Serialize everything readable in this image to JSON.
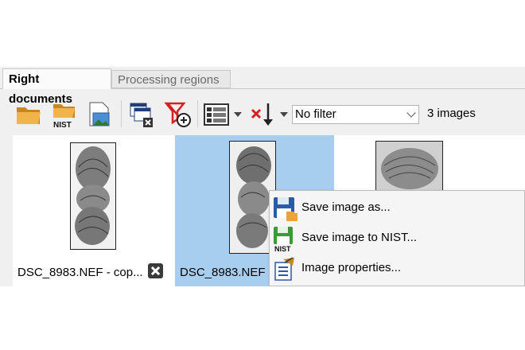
{
  "tabs": [
    {
      "label": "Right documents",
      "active": true
    },
    {
      "label": "Processing regions",
      "active": false
    }
  ],
  "toolbar": {
    "buttons": [
      "open-folder-icon",
      "open-nist-icon",
      "import-image-icon",
      "close-windows-icon",
      "remove-filter-icon",
      "view-mode-icon",
      "sort-icon"
    ],
    "nist_badge": "NIST",
    "filter": {
      "selected": "No filter"
    },
    "image_count": "3 images"
  },
  "gallery": {
    "items": [
      {
        "caption": "DSC_8983.NEF - cop...",
        "selected": false
      },
      {
        "caption": "DSC_8983.NEF - ",
        "selected": true
      },
      {
        "caption": "",
        "selected": false
      }
    ]
  },
  "context_menu": {
    "items": [
      {
        "label": "Save image as...",
        "icon": "floppy-save-icon"
      },
      {
        "label": "Save image to NIST...",
        "icon": "nist-save-icon"
      },
      {
        "label": "Image properties...",
        "icon": "properties-icon"
      }
    ],
    "nist_badge": "NIST"
  },
  "colors": {
    "selection": "#a7cdef",
    "folder": "#e8a53a",
    "save_blue": "#2b5aa8",
    "save_green": "#3a9a3a",
    "remove_red": "#d62020"
  }
}
